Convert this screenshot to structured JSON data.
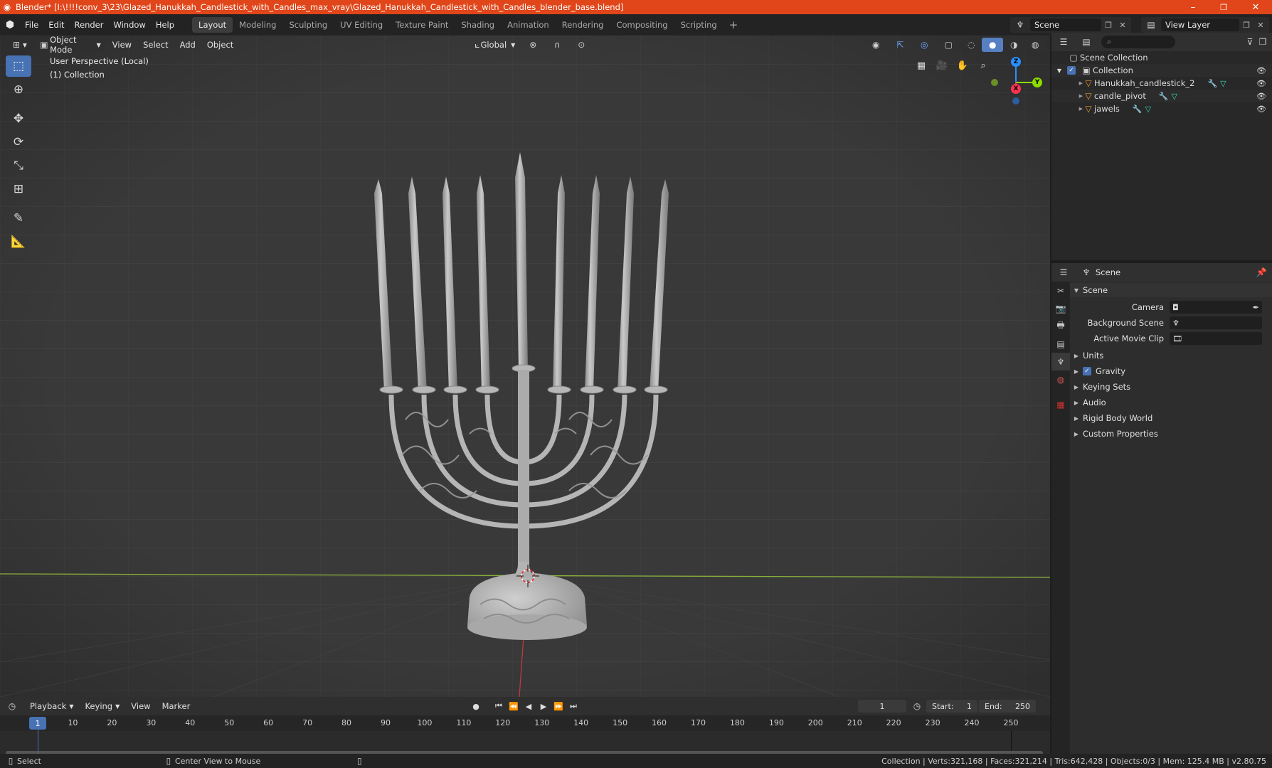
{
  "window": {
    "title": "Blender* [I:\\!!!!conv_3\\23\\Glazed_Hanukkah_Candlestick_with_Candles_max_vray\\Glazed_Hanukkah_Candlestick_with_Candles_blender_base.blend]",
    "minimize": "–",
    "maximize": "❐",
    "close": "✕"
  },
  "menu": {
    "items": [
      "File",
      "Edit",
      "Render",
      "Window",
      "Help"
    ]
  },
  "workspaces": {
    "tabs": [
      "Layout",
      "Modeling",
      "Sculpting",
      "UV Editing",
      "Texture Paint",
      "Shading",
      "Animation",
      "Rendering",
      "Compositing",
      "Scripting"
    ],
    "active": "Layout",
    "add": "+"
  },
  "scene_selector": {
    "value": "Scene"
  },
  "view_layer_selector": {
    "value": "View Layer"
  },
  "viewport": {
    "mode": "Object Mode",
    "menus": [
      "View",
      "Select",
      "Add",
      "Object"
    ],
    "orientation": "Global",
    "info_line1": "User Perspective (Local)",
    "info_line2": "(1) Collection",
    "gizmo": {
      "z": "Z",
      "x": "X",
      "y": "Y"
    }
  },
  "outliner": {
    "root": "Scene Collection",
    "collection": "Collection",
    "objects": [
      "Hanukkah_candlestick_2",
      "candle_pivot",
      "jawels"
    ]
  },
  "properties": {
    "header": "Scene",
    "panel": "Scene",
    "camera_label": "Camera",
    "background_label": "Background Scene",
    "movieclip_label": "Active Movie Clip",
    "sections": [
      "Units",
      "Gravity",
      "Keying Sets",
      "Audio",
      "Rigid Body World",
      "Custom Properties"
    ]
  },
  "timeline": {
    "menus": [
      "Playback",
      "Keying",
      "View",
      "Marker"
    ],
    "current_frame": "1",
    "start_label": "Start:",
    "start": "1",
    "end_label": "End:",
    "end": "250",
    "ruler": [
      "1",
      "10",
      "20",
      "30",
      "40",
      "50",
      "60",
      "70",
      "80",
      "90",
      "100",
      "110",
      "120",
      "130",
      "140",
      "150",
      "160",
      "170",
      "180",
      "190",
      "200",
      "210",
      "220",
      "230",
      "240",
      "250"
    ]
  },
  "status": {
    "select": "Select",
    "center": "Center View to Mouse",
    "stats": "Collection | Verts:321,168 | Faces:321,214 | Tris:642,428 | Objects:0/3 | Mem: 125.4 MB | v2.80.75"
  },
  "colors": {
    "title_bar": "#e0461a",
    "accent": "#4772b3",
    "object_orange": "#e8962f",
    "axis_x": "#ff3352",
    "axis_y": "#8bdc00",
    "axis_z": "#2890ff"
  }
}
